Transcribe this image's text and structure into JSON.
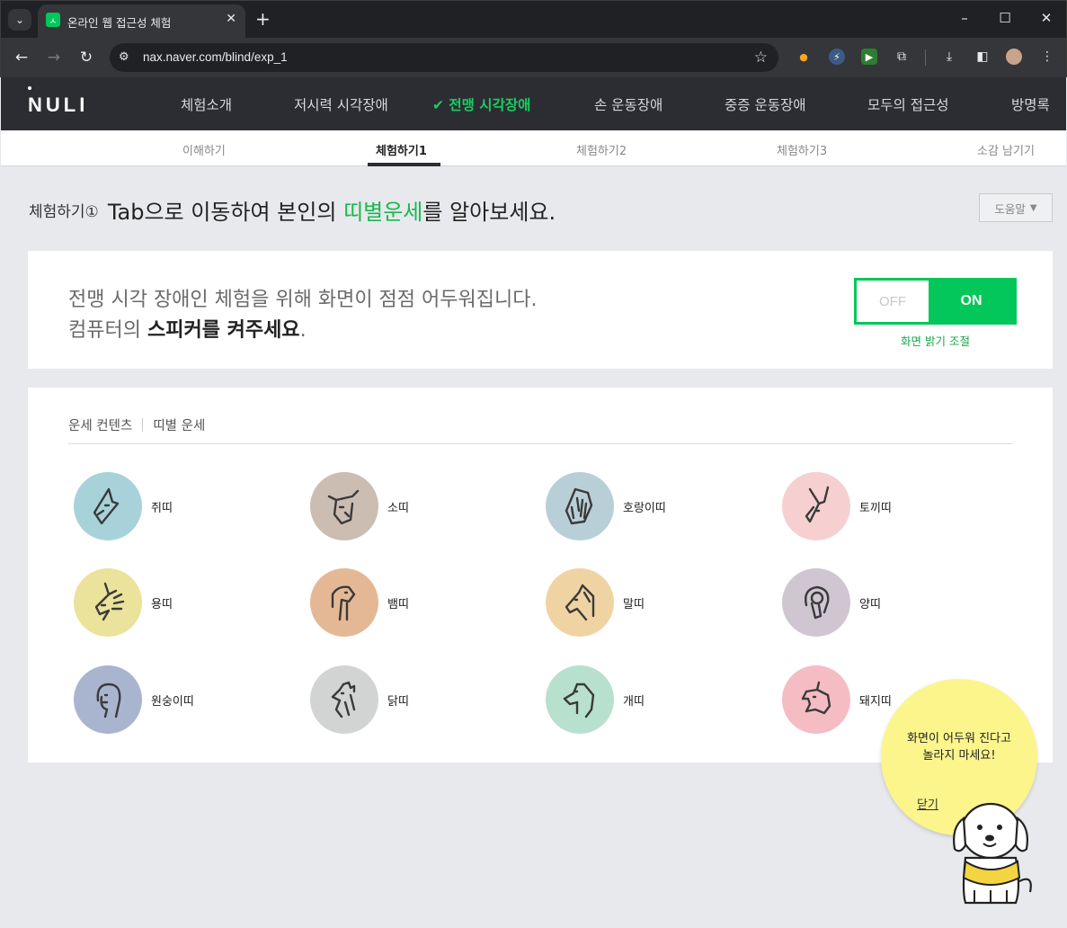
{
  "browser": {
    "tab_title": "온라인 웹 접근성 체험",
    "url": "nax.naver.com/blind/exp_1"
  },
  "site": {
    "logo": "NULI",
    "gnb": [
      {
        "label": "체험소개"
      },
      {
        "label": "저시력 시각장애"
      },
      {
        "label": "전맹 시각장애",
        "active": true
      },
      {
        "label": "손 운동장애"
      },
      {
        "label": "중증 운동장애"
      },
      {
        "label": "모두의 접근성"
      },
      {
        "label": "방명록"
      }
    ],
    "subnav": [
      {
        "label": "이해하기"
      },
      {
        "label": "체험하기1",
        "active": true
      },
      {
        "label": "체험하기2"
      },
      {
        "label": "체험하기3"
      },
      {
        "label": "소감 남기기"
      }
    ]
  },
  "heading": {
    "prefix": "체험하기①",
    "text_before": "Tab으로 이동하여 본인의 ",
    "highlight": "띠별운세",
    "text_after": "를 알아보세요.",
    "help_label": "도움말"
  },
  "notice": {
    "line1": "전맹 시각 장애인 체험을 위해 화면이 점점 어두워집니다.",
    "line2_prefix": "컴퓨터의 ",
    "line2_bold": "스피커를 켜주세요",
    "line2_suffix": ".",
    "toggle_off": "OFF",
    "toggle_on": "ON",
    "toggle_state": "ON",
    "toggle_caption": "화면 밝기 조절"
  },
  "fortune": {
    "breadcrumb_1": "운세 컨텐츠",
    "breadcrumb_2": "띠별 운세",
    "items": [
      {
        "label": "쥐띠",
        "icon": "rat-icon",
        "color": "#a8d2d9"
      },
      {
        "label": "소띠",
        "icon": "ox-icon",
        "color": "#cbbdb1"
      },
      {
        "label": "호랑이띠",
        "icon": "tiger-icon",
        "color": "#b8cfd8"
      },
      {
        "label": "토끼띠",
        "icon": "rabbit-icon",
        "color": "#f6cfd0"
      },
      {
        "label": "용띠",
        "icon": "dragon-icon",
        "color": "#ebe29b"
      },
      {
        "label": "뱀띠",
        "icon": "snake-icon",
        "color": "#e5b895"
      },
      {
        "label": "말띠",
        "icon": "horse-icon",
        "color": "#f0d3a3"
      },
      {
        "label": "양띠",
        "icon": "sheep-icon",
        "color": "#cfc6d1"
      },
      {
        "label": "원숭이띠",
        "icon": "monkey-icon",
        "color": "#a9b5cf"
      },
      {
        "label": "닭띠",
        "icon": "rooster-icon",
        "color": "#d2d3d3"
      },
      {
        "label": "개띠",
        "icon": "dog-icon",
        "color": "#b7e0cf"
      },
      {
        "label": "돼지띠",
        "icon": "pig-icon",
        "color": "#f5bcc4"
      }
    ]
  },
  "bubble": {
    "line1": "화면이 어두워 진다고",
    "line2": "놀라지 마세요!",
    "close_label": "닫기"
  }
}
